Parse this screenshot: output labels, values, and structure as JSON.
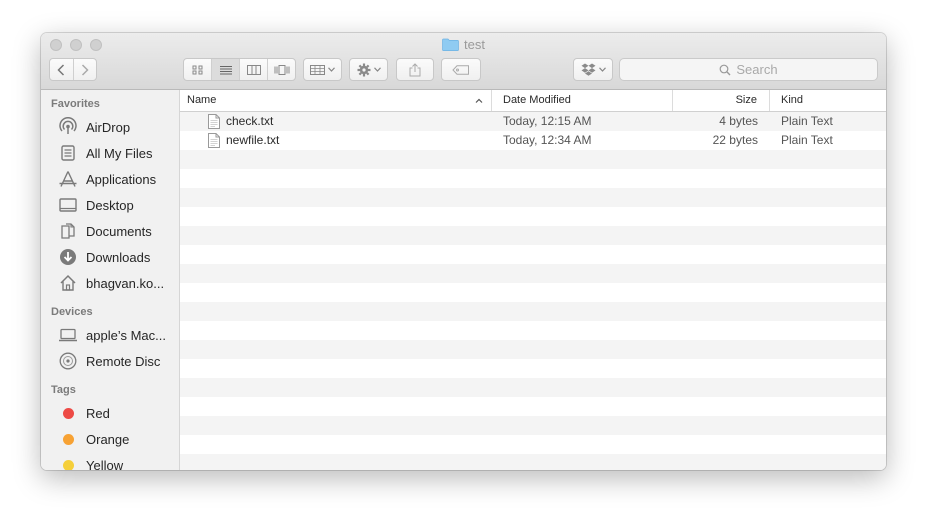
{
  "window": {
    "title": "test"
  },
  "toolbar": {
    "search_placeholder": "Search",
    "back_label": "‹",
    "forward_label": "›"
  },
  "sidebar": {
    "favorites_label": "Favorites",
    "favorites": [
      {
        "label": "AirDrop",
        "icon": "airdrop-icon"
      },
      {
        "label": "All My Files",
        "icon": "all-my-files-icon"
      },
      {
        "label": "Applications",
        "icon": "applications-icon"
      },
      {
        "label": "Desktop",
        "icon": "desktop-icon"
      },
      {
        "label": "Documents",
        "icon": "documents-icon"
      },
      {
        "label": "Downloads",
        "icon": "downloads-icon"
      },
      {
        "label": "bhagvan.ko...",
        "icon": "home-icon"
      }
    ],
    "devices_label": "Devices",
    "devices": [
      {
        "label": "apple’s Mac...",
        "icon": "laptop-icon"
      },
      {
        "label": "Remote Disc",
        "icon": "remote-disc-icon"
      }
    ],
    "tags_label": "Tags",
    "tags": [
      {
        "label": "Red",
        "color": "#ed4a45"
      },
      {
        "label": "Orange",
        "color": "#f7a234"
      },
      {
        "label": "Yellow",
        "color": "#f5cf3a"
      }
    ]
  },
  "columns": {
    "name": "Name",
    "date": "Date Modified",
    "size": "Size",
    "kind": "Kind"
  },
  "files": [
    {
      "name": "check.txt",
      "date": "Today, 12:15 AM",
      "size": "4 bytes",
      "kind": "Plain Text"
    },
    {
      "name": "newfile.txt",
      "date": "Today, 12:34 AM",
      "size": "22 bytes",
      "kind": "Plain Text"
    }
  ],
  "colors": {
    "folder": "#8fcbf2",
    "accent": "#3b99fc"
  }
}
